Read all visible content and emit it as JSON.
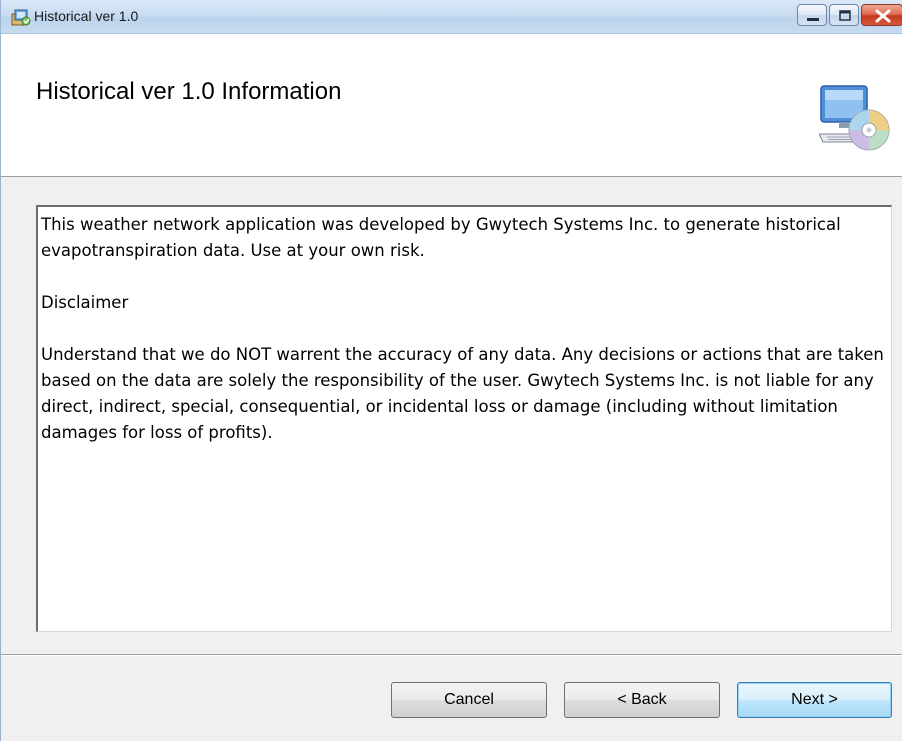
{
  "window": {
    "title": "Historical ver 1.0",
    "icon": "installer-icon"
  },
  "caption_buttons": {
    "minimize": "minimize-icon",
    "maximize": "maximize-icon",
    "close": "close-icon"
  },
  "banner": {
    "title": "Historical ver 1.0 Information",
    "icon": "computer-disc-icon"
  },
  "content": {
    "paragraphs": [
      "This weather network application was developed by Gwytech Systems Inc. to generate historical evapotranspiration data. Use at your own risk.",
      "Disclaimer",
      "Understand that we do NOT warrent the accuracy of any data. Any decisions or actions that are taken based on the data are solely the responsibility of the user. Gwytech Systems Inc. is not liable for any direct, indirect, special, consequential, or incidental loss or damage (including without limitation damages for loss of profits)."
    ]
  },
  "buttons": {
    "cancel": "Cancel",
    "back": "< Back",
    "next": "Next >"
  },
  "colors": {
    "accent_button_border": "#3c7fb1",
    "close_button": "#c6391e",
    "titlebar": "#c9dcf1"
  }
}
